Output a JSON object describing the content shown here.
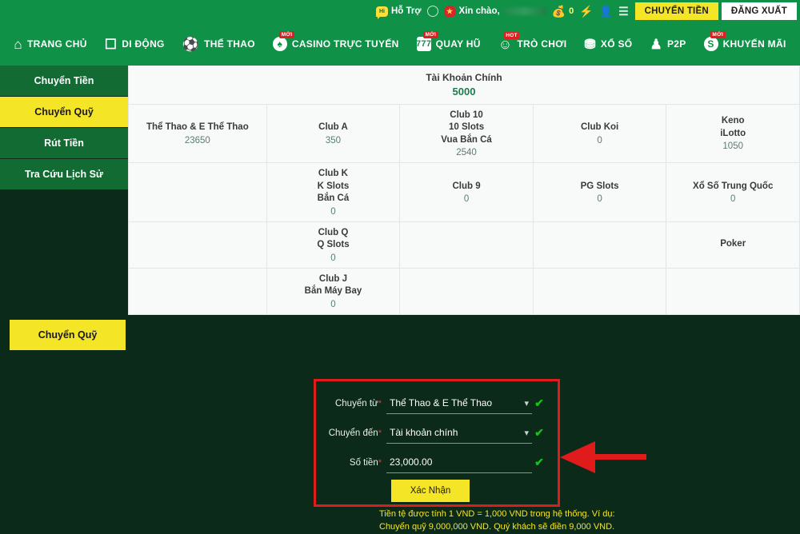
{
  "topbar": {
    "support_label": "Hỗ Trợ",
    "support_badge": "Hi",
    "greeting": "Xin chào,",
    "username_redacted": "",
    "balance_count": "0",
    "transfer_button": "CHUYỂN TIỀN",
    "logout_button": "ĐĂNG XUẤT"
  },
  "nav": {
    "items": [
      {
        "label": "TRANG CHỦ",
        "icon": "home-icon",
        "glyph": "⌂",
        "badge": ""
      },
      {
        "label": "DI ĐỘNG",
        "icon": "mobile-icon",
        "glyph": "☐",
        "badge": ""
      },
      {
        "label": "THỂ THAO",
        "icon": "soccer-icon",
        "glyph": "⚽",
        "badge": ""
      },
      {
        "label": "CASINO TRỰC TUYẾN",
        "icon": "cards-icon",
        "glyph": "♠",
        "badge": "MỚI"
      },
      {
        "label": "QUAY HŨ",
        "icon": "slot-777-icon",
        "glyph": "777",
        "badge": "MỚI"
      },
      {
        "label": "TRÒ CHƠI",
        "icon": "joystick-icon",
        "glyph": "☺",
        "badge": "HOT"
      },
      {
        "label": "XỔ SỐ",
        "icon": "lottery-balls-icon",
        "glyph": "⛃",
        "badge": ""
      },
      {
        "label": "P2P",
        "icon": "people-icon",
        "glyph": "♟",
        "badge": ""
      },
      {
        "label": "KHUYẾN MÃI",
        "icon": "promo-icon",
        "glyph": "S",
        "badge": "MỚI"
      }
    ]
  },
  "sidebar": {
    "items": [
      {
        "label": "Chuyển Tiền",
        "active": false
      },
      {
        "label": "Chuyển Quỹ",
        "active": true
      },
      {
        "label": "Rút Tiền",
        "active": false
      },
      {
        "label": "Tra Cứu Lịch Sử",
        "active": false
      }
    ],
    "action_button": "Chuyển Quỹ"
  },
  "accounts": {
    "main": {
      "name": "Tài Khoản Chính",
      "value": "5000"
    },
    "grid": [
      [
        {
          "name": "Thể Thao & E Thể Thao",
          "value": "23650"
        },
        {
          "name": "Club A",
          "value": "350"
        },
        {
          "name": "Club 10\n10 Slots\nVua Bắn Cá",
          "value": "2540"
        },
        {
          "name": "Club Koi",
          "value": "0"
        },
        {
          "name": "Keno\niLotto",
          "value": "1050"
        }
      ],
      [
        {
          "name": "",
          "value": ""
        },
        {
          "name": "Club K\nK Slots\nBắn Cá",
          "value": "0"
        },
        {
          "name": "Club 9",
          "value": "0"
        },
        {
          "name": "PG Slots",
          "value": "0"
        },
        {
          "name": "Xổ Số Trung Quốc",
          "value": "0"
        }
      ],
      [
        {
          "name": "",
          "value": ""
        },
        {
          "name": "Club Q\nQ Slots",
          "value": "0"
        },
        {
          "name": "",
          "value": ""
        },
        {
          "name": "",
          "value": ""
        },
        {
          "name": "Poker",
          "value": ""
        }
      ],
      [
        {
          "name": "",
          "value": ""
        },
        {
          "name": "Club J\nBắn Máy Bay",
          "value": "0"
        },
        {
          "name": "",
          "value": ""
        },
        {
          "name": "",
          "value": ""
        },
        {
          "name": "",
          "value": ""
        }
      ]
    ]
  },
  "form": {
    "from_label": "Chuyển từ",
    "from_value": "Thể Thao & E Thể Thao",
    "to_label": "Chuyển đến",
    "to_value": "Tài khoản chính",
    "amount_label": "Số tiền",
    "amount_value": "23,000.00",
    "required_mark": "*",
    "submit_button": "Xác Nhận"
  },
  "note": {
    "text": "Tiền tệ được tính 1 VND = 1,000 VND trong hệ thống. Ví dụ: Chuyển quỹ 9,000,000 VND. Quý khách sẽ điền 9,000 VND."
  },
  "colors": {
    "header_green": "#0f9247",
    "page_green": "#0c2a1a",
    "accent_yellow": "#f5e527",
    "highlight_red": "#e01b1b",
    "check_green": "#17c217"
  }
}
